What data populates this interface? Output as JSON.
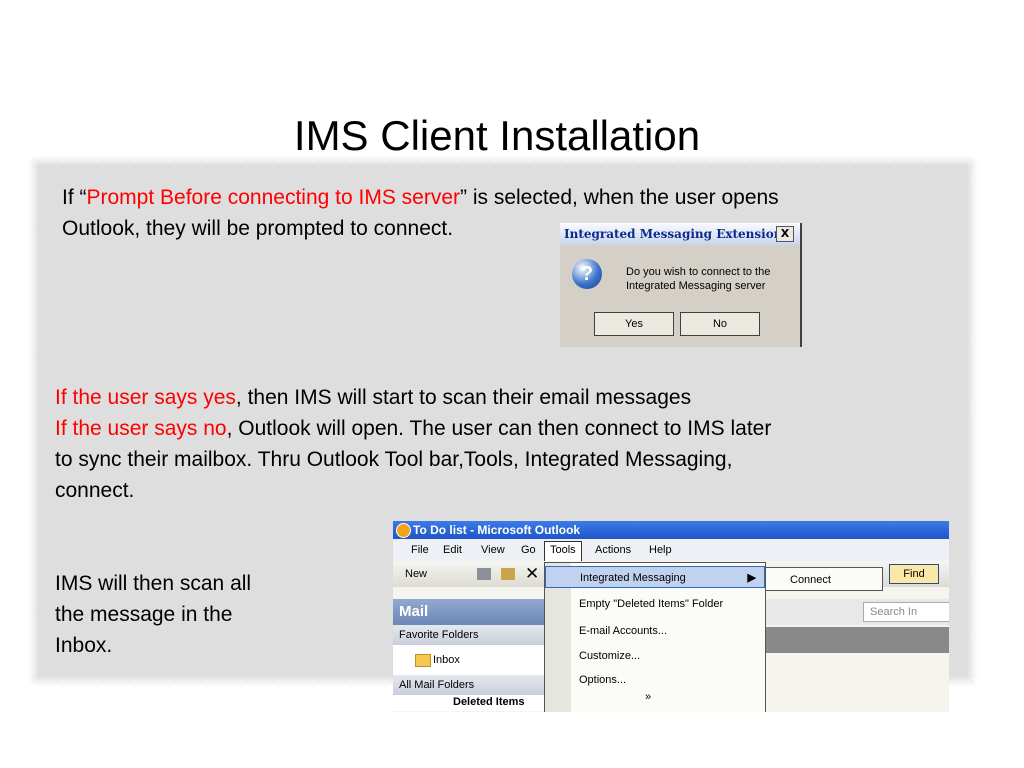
{
  "slide": {
    "title": "IMS Client Installation",
    "para1_pre": "If “",
    "para1_red": "Prompt Before connecting to IMS server",
    "para1_post": "” is selected, when the user opens",
    "para1_line2": "Outlook, they will be prompted to connect.",
    "yes_red": "If the user says yes",
    "yes_rest": ", then IMS will start to scan their email messages",
    "no_red": "If the user says no",
    "no_rest": ", Outlook will open.  The user can then connect to IMS later",
    "line3": "to sync their mailbox.  Thru Outlook Tool bar,Tools, Integrated Messaging,",
    "line4": "connect.",
    "scan_text": [
      "IMS will then scan all",
      "the message in the",
      "Inbox."
    ]
  },
  "dialog": {
    "title": "Integrated Messaging Extension",
    "close": "X",
    "message": [
      "Do you wish to connect to the",
      "Integrated Messaging server"
    ],
    "yes": "Yes",
    "no": "No"
  },
  "outlook": {
    "title": "To Do list - Microsoft Outlook",
    "menu": [
      "File",
      "Edit",
      "View",
      "Go",
      "Tools",
      "Actions",
      "Help"
    ],
    "toolbar_new": "New",
    "find": "Find",
    "pane_title": "Mail",
    "favorite_folders": "Favorite Folders",
    "inbox": "Inbox",
    "all_mail_folders": "All Mail Folders",
    "deleted_items": "Deleted Items",
    "search_in": "Search In",
    "tools_menu": [
      "Integrated Messaging",
      "Empty \"Deleted Items\" Folder",
      "E-mail Accounts...",
      "Customize...",
      "Options..."
    ],
    "submenu": "Connect"
  }
}
